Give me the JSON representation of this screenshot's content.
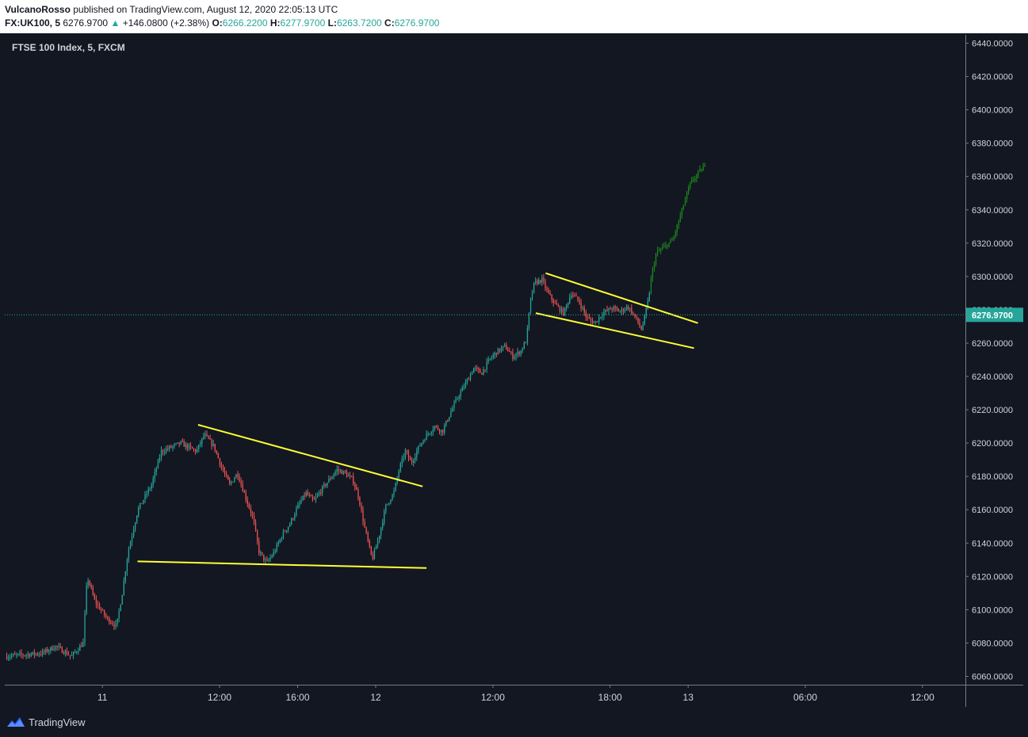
{
  "header": {
    "publisher": "VulcanoRosso",
    "published_text": "published on TradingView.com, August 12, 2020 22:05:13 UTC",
    "symbol": "FX:UK100, 5",
    "last": "6276.9700",
    "change_arrow": "▲",
    "change": "+146.0800 (+2.38%)",
    "o_label": "O:",
    "o_value": "6266.2200",
    "h_label": "H:",
    "h_value": "6277.9700",
    "l_label": "L:",
    "l_value": "6263.7200",
    "c_label": "C:",
    "c_value": "6276.9700"
  },
  "chart_title": "FTSE 100 Index, 5, FXCM",
  "footer": {
    "brand": "TradingView"
  },
  "colors": {
    "background": "#131722",
    "up": "#26a69a",
    "down": "#ef5350",
    "late_up": "#1b8a1b",
    "trendline": "#ffff33",
    "price_line": "#26a69a",
    "axis_text": "#d1d4dc"
  },
  "chart_data": {
    "type": "candlestick",
    "y_axis": {
      "range": [
        6055,
        6445
      ],
      "ticks": [
        "6060.0000",
        "6080.0000",
        "6100.0000",
        "6120.0000",
        "6140.0000",
        "6160.0000",
        "6180.0000",
        "6200.0000",
        "6220.0000",
        "6240.0000",
        "6260.0000",
        "6280.0000",
        "6300.0000",
        "6320.0000",
        "6340.0000",
        "6360.0000",
        "6380.0000",
        "6400.0000",
        "6420.0000",
        "6440.0000"
      ]
    },
    "x_axis": {
      "range_hours": [
        -5,
        44.2
      ],
      "ticks": [
        {
          "label": "11",
          "hour": 0
        },
        {
          "label": "12:00",
          "hour": 6
        },
        {
          "label": "16:00",
          "hour": 10
        },
        {
          "label": "12",
          "hour": 14
        },
        {
          "label": "12:00",
          "hour": 20
        },
        {
          "label": "18:00",
          "hour": 26
        },
        {
          "label": "13",
          "hour": 30
        },
        {
          "label": "06:00",
          "hour": 36
        },
        {
          "label": "12:00",
          "hour": 42
        }
      ]
    },
    "current_price": 6276.97,
    "current_price_label": "6276.9700",
    "price_path": [
      [
        -4.9,
        6072
      ],
      [
        -3.0,
        6074
      ],
      [
        -2.3,
        6078
      ],
      [
        -1.5,
        6072
      ],
      [
        -0.9,
        6080
      ],
      [
        -0.7,
        6120
      ],
      [
        -0.3,
        6105
      ],
      [
        0.3,
        6095
      ],
      [
        0.8,
        6090
      ],
      [
        1.1,
        6110
      ],
      [
        1.4,
        6135
      ],
      [
        1.9,
        6160
      ],
      [
        2.6,
        6175
      ],
      [
        3.1,
        6195
      ],
      [
        4.1,
        6200
      ],
      [
        4.9,
        6195
      ],
      [
        5.3,
        6205
      ],
      [
        5.8,
        6198
      ],
      [
        6.2,
        6185
      ],
      [
        6.6,
        6175
      ],
      [
        7.0,
        6182
      ],
      [
        7.4,
        6168
      ],
      [
        7.8,
        6155
      ],
      [
        8.1,
        6135
      ],
      [
        8.5,
        6128
      ],
      [
        8.9,
        6135
      ],
      [
        9.3,
        6145
      ],
      [
        9.7,
        6152
      ],
      [
        10.1,
        6162
      ],
      [
        10.5,
        6170
      ],
      [
        10.9,
        6165
      ],
      [
        11.3,
        6172
      ],
      [
        11.7,
        6178
      ],
      [
        12.1,
        6184
      ],
      [
        12.5,
        6182
      ],
      [
        12.9,
        6178
      ],
      [
        13.2,
        6168
      ],
      [
        13.5,
        6150
      ],
      [
        13.9,
        6130
      ],
      [
        14.2,
        6142
      ],
      [
        14.6,
        6162
      ],
      [
        15.0,
        6170
      ],
      [
        15.3,
        6185
      ],
      [
        15.6,
        6195
      ],
      [
        15.9,
        6188
      ],
      [
        16.3,
        6198
      ],
      [
        16.7,
        6205
      ],
      [
        17.1,
        6210
      ],
      [
        17.5,
        6207
      ],
      [
        17.9,
        6218
      ],
      [
        18.3,
        6228
      ],
      [
        18.7,
        6236
      ],
      [
        19.1,
        6245
      ],
      [
        19.5,
        6242
      ],
      [
        19.9,
        6250
      ],
      [
        20.3,
        6255
      ],
      [
        20.7,
        6258
      ],
      [
        21.1,
        6252
      ],
      [
        21.5,
        6255
      ],
      [
        21.8,
        6262
      ],
      [
        22.0,
        6285
      ],
      [
        22.2,
        6296
      ],
      [
        22.6,
        6298
      ],
      [
        22.9,
        6290
      ],
      [
        23.3,
        6283
      ],
      [
        23.7,
        6278
      ],
      [
        24.1,
        6290
      ],
      [
        24.5,
        6285
      ],
      [
        24.9,
        6275
      ],
      [
        25.3,
        6272
      ],
      [
        25.7,
        6278
      ],
      [
        26.2,
        6281
      ],
      [
        26.6,
        6279
      ],
      [
        27.0,
        6282
      ],
      [
        27.4,
        6275
      ],
      [
        27.7,
        6268
      ],
      [
        27.9,
        6278
      ],
      [
        28.05,
        6286
      ],
      [
        28.2,
        6300
      ],
      [
        28.45,
        6314
      ],
      [
        28.9,
        6318
      ],
      [
        29.3,
        6322
      ],
      [
        29.6,
        6333
      ],
      [
        29.9,
        6345
      ],
      [
        30.2,
        6356
      ],
      [
        30.6,
        6362
      ],
      [
        30.9,
        6366
      ]
    ],
    "trendlines": [
      {
        "name": "upper-left",
        "from": [
          4.9,
          6211
        ],
        "to": [
          16.4,
          6174
        ]
      },
      {
        "name": "lower-left",
        "from": [
          1.8,
          6129
        ],
        "to": [
          16.6,
          6125
        ]
      },
      {
        "name": "upper-right",
        "from": [
          22.7,
          6302
        ],
        "to": [
          30.5,
          6272
        ]
      },
      {
        "name": "lower-right",
        "from": [
          22.2,
          6278
        ],
        "to": [
          30.3,
          6257
        ]
      }
    ]
  }
}
